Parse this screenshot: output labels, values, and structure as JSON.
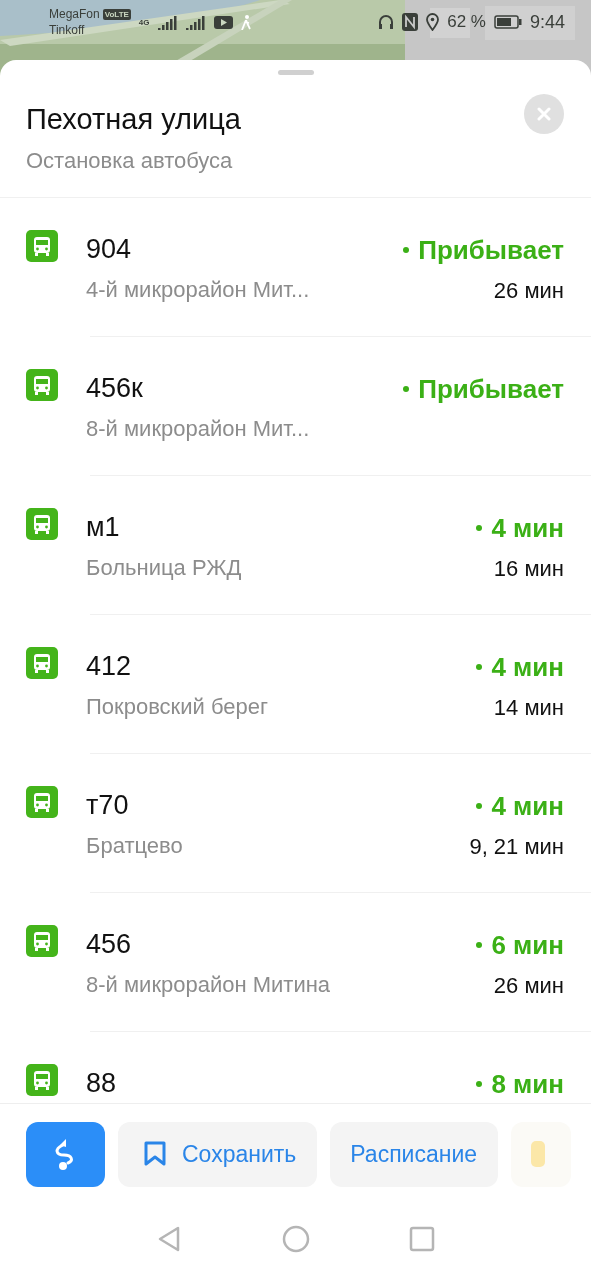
{
  "status_bar": {
    "carrier_1": "MegaFon",
    "volte": "VoLTE",
    "network": "4G",
    "carrier_2": "Tinkoff",
    "battery": "62 %",
    "time": "9:44"
  },
  "stop": {
    "title": "Пехотная улица",
    "subtitle": "Остановка автобуса"
  },
  "routes": [
    {
      "number": "904",
      "destination": "4-й микрорайон Мит...",
      "arrival": "Прибывает",
      "next": "26 мин"
    },
    {
      "number": "456к",
      "destination": "8-й микрорайон Мит...",
      "arrival": "Прибывает"
    },
    {
      "number": "м1",
      "destination": "Больница РЖД",
      "arrival": "4 мин",
      "next": "16 мин"
    },
    {
      "number": "412",
      "destination": "Покровский берег",
      "arrival": "4 мин",
      "next": "14 мин"
    },
    {
      "number": "т70",
      "destination": "Братцево",
      "arrival": "4 мин",
      "next": "9, 21 мин"
    },
    {
      "number": "456",
      "destination": "8-й микрорайон Митина",
      "arrival": "6 мин",
      "next": "26 мин"
    },
    {
      "number": "88",
      "arrival": "8 мин"
    }
  ],
  "actions": [
    {
      "kind": "route"
    },
    {
      "kind": "save",
      "label": "Сохранить"
    },
    {
      "kind": "text",
      "label": "Расписание"
    },
    {
      "kind": "partial"
    }
  ]
}
